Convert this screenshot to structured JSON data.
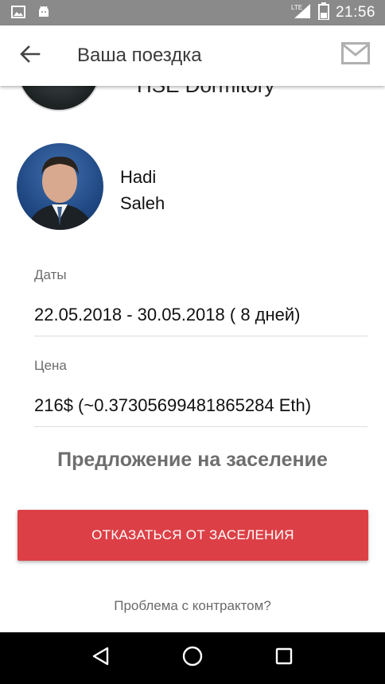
{
  "status_bar": {
    "time": "21:56",
    "network": "LTE",
    "icons": [
      "image-icon",
      "android-icon",
      "signal-icon",
      "battery-icon"
    ]
  },
  "app_bar": {
    "title": "Ваша поездка",
    "back_icon": "arrow-back-icon",
    "mail_icon": "mail-icon"
  },
  "listing": {
    "name_partial": "HSE Dormitory"
  },
  "host": {
    "first_name": "Hadi",
    "last_name": "Saleh"
  },
  "dates": {
    "label": "Даты",
    "value": "22.05.2018 - 30.05.2018 ( 8 дней)"
  },
  "price": {
    "label": "Цена",
    "value": "216$ (~0.37305699481865284 Eth)"
  },
  "offer": {
    "title": "Предложение на заселение",
    "decline_button": "ОТКАЗАТЬСЯ ОТ ЗАСЕЛЕНИЯ",
    "problem_link": "Проблема с контрактом?"
  },
  "colors": {
    "accent_red": "#dc4046",
    "status_bar": "#8a8a8a",
    "nav_bar": "#000000"
  },
  "nav_bar": {
    "icons": [
      "back-triangle-icon",
      "home-circle-icon",
      "recents-square-icon"
    ]
  }
}
